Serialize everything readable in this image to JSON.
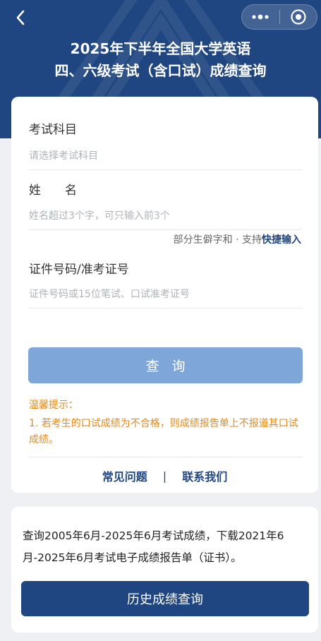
{
  "header": {
    "title_line1": "2025年下半年全国大学英语",
    "title_line2": "四、六级考试（含口试）成绩查询",
    "back_icon": "chevron-left-icon",
    "more_icon": "more-dots-icon",
    "close_icon": "target-close-icon"
  },
  "form": {
    "subject": {
      "label": "考试科目",
      "placeholder": "请选择考试科目"
    },
    "name": {
      "label": "姓　　名",
      "placeholder": "姓名超过3个字，可只输入前3个"
    },
    "rare_hint": {
      "text": "部分生僻字和 · 支持",
      "link": "快捷输入"
    },
    "id_number": {
      "label": "证件号码/准考证号",
      "placeholder": "证件号码或15位笔试、口试准考证号"
    },
    "query_button": "查询"
  },
  "tips": {
    "title": "温馨提示：",
    "body": "1. 若考生的口试成绩为不合格，则成绩报告单上不报道其口试成绩。"
  },
  "links": {
    "faq": "常见问题",
    "separator": "|",
    "contact": "联系我们"
  },
  "history": {
    "description": "查询2005年6月-2025年6月考试成绩，下载2021年6月-2025年6月考试电子成绩报告单（证书）。",
    "button": "历史成绩查询"
  },
  "colors": {
    "brand": "#1f4680",
    "query_button": "#7fa6d8",
    "tips": "#e08a1e",
    "background": "#eef0f4"
  }
}
